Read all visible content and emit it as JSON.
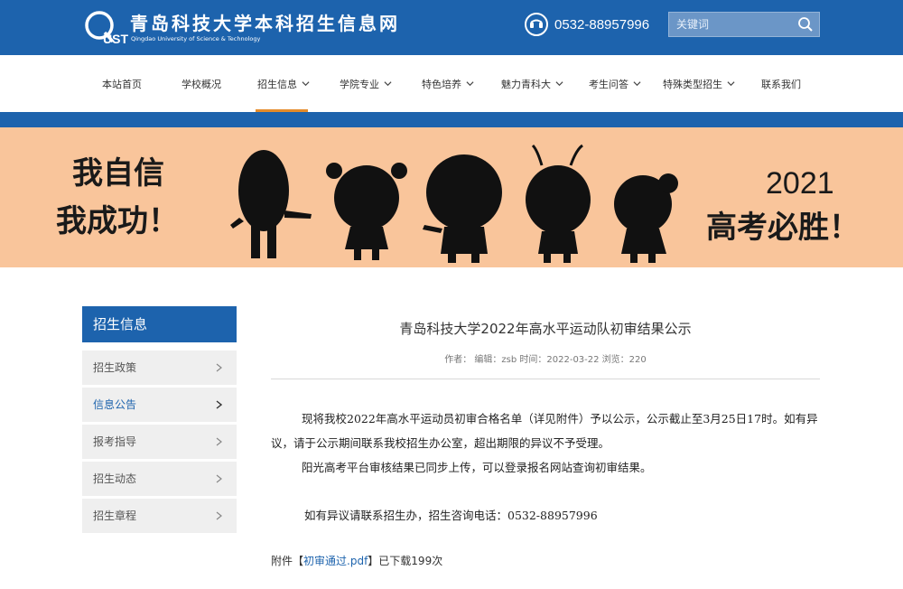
{
  "header": {
    "logo_mark": "QUST",
    "logo_cn": "青岛科技大学本科招生信息网",
    "logo_en": "Qingdao University of Science & Technology",
    "phone": "0532-88957996",
    "search_placeholder": "关键词"
  },
  "nav": [
    {
      "label": "本站首页",
      "dropdown": false,
      "active": false
    },
    {
      "label": "学校概况",
      "dropdown": false,
      "active": false
    },
    {
      "label": "招生信息",
      "dropdown": true,
      "active": true
    },
    {
      "label": "学院专业",
      "dropdown": true,
      "active": false
    },
    {
      "label": "特色培养",
      "dropdown": true,
      "active": false
    },
    {
      "label": "魅力青科大",
      "dropdown": true,
      "active": false
    },
    {
      "label": "考生问答",
      "dropdown": true,
      "active": false
    },
    {
      "label": "特殊类型招生",
      "dropdown": true,
      "active": false
    },
    {
      "label": "联系我们",
      "dropdown": false,
      "active": false
    }
  ],
  "banner": {
    "left_line1": "我自信",
    "left_line2": "我成功！",
    "right_year": "2021",
    "right_line": "高考必胜！"
  },
  "sidebar": {
    "title": "招生信息",
    "items": [
      {
        "label": "招生政策"
      },
      {
        "label": "信息公告"
      },
      {
        "label": "报考指导"
      },
      {
        "label": "招生动态"
      },
      {
        "label": "招生章程"
      }
    ]
  },
  "article": {
    "title": "青岛科技大学2022年高水平运动队初审结果公示",
    "meta": "作者： 编辑：zsb 时间：2022-03-22 浏览：220",
    "para1": "现将我校2022年高水平运动员初审合格名单（详见附件）予以公示，公示截止至3月25日17时。如有异议，请于公示期间联系我校招生办公室，超出期限的异议不予受理。",
    "para2": "阳光高考平台审核结果已同步上传，可以登录报名网站查询初审结果。",
    "para3": "如有异议请联系招生办，招生咨询电话：0532-88957996",
    "attach_prefix": "附件【",
    "attach_link": "初审通过.pdf",
    "attach_suffix": "】已下载199次"
  },
  "colors": {
    "primary": "#1d63ad",
    "accent": "#e58b2a",
    "banner_bg": "#f9c59b"
  }
}
